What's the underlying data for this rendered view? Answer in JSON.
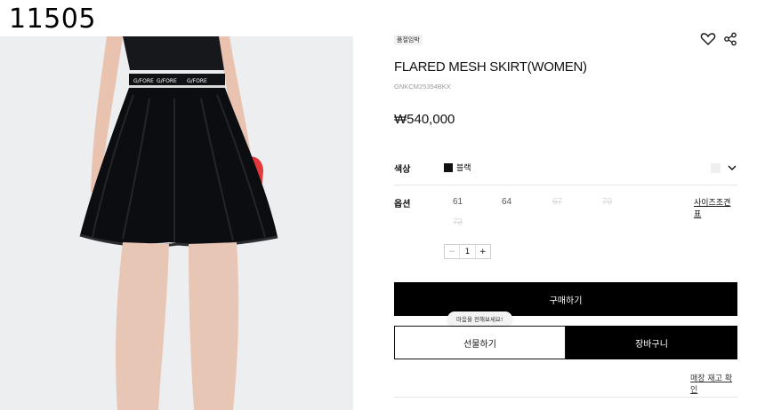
{
  "overlay_id": "11505",
  "product": {
    "badge": "품절임박",
    "title": "FLARED MESH SKIRT(WOMEN)",
    "code": "GNKCM25354BKX",
    "price": "₩540,000",
    "photo_logo": "G/FORE",
    "wishlist_icon": "heart-icon",
    "share_icon": "share-icon"
  },
  "options": {
    "color_label": "색상",
    "color_value": "블랙",
    "color_hex": "#111111",
    "size_label": "옵션",
    "sizes": [
      {
        "label": "61",
        "soldout": false
      },
      {
        "label": "64",
        "soldout": false
      },
      {
        "label": "67",
        "soldout": true
      },
      {
        "label": "70",
        "soldout": true
      },
      {
        "label": "73",
        "soldout": true
      }
    ],
    "size_guide": "사이즈조견표",
    "quantity": {
      "minus": "−",
      "value": "1",
      "plus": "+"
    }
  },
  "actions": {
    "buy": "구매하기",
    "tooltip": "마음을 전해보세요!",
    "gift": "선물하기",
    "cart": "장바구니",
    "store_stock": "매장 재고 확인"
  }
}
